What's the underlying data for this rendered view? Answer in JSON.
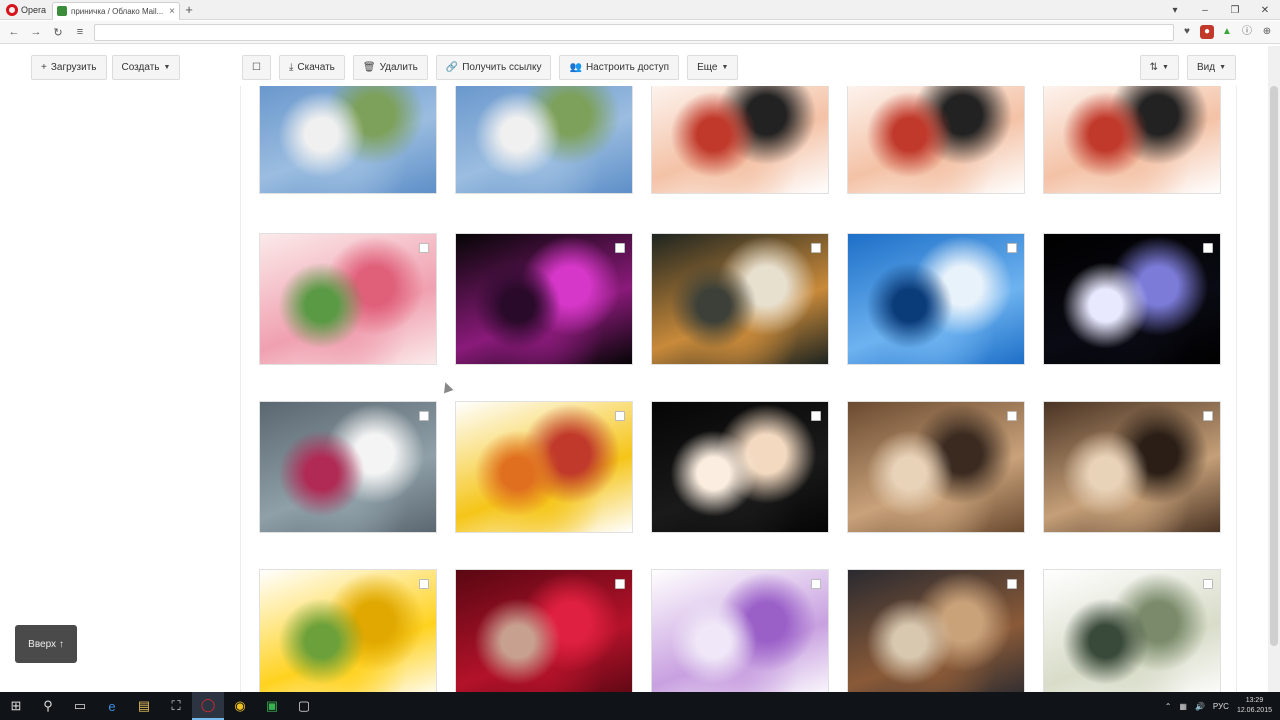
{
  "browser": {
    "menu_label": "Opera",
    "tab_title": "приничка / Облако Mail...",
    "tab_close": "×",
    "new_tab": "+"
  },
  "sidebar_actions": {
    "upload_label": "Загрузить",
    "create_label": "Создать"
  },
  "toolbar": {
    "download_label": "Скачать",
    "delete_label": "Удалить",
    "get_link_label": "Получить ссылку",
    "access_label": "Настроить доступ",
    "more_label": "Еще",
    "view_label": "Вид"
  },
  "up_button_label": "Вверх ↑",
  "taskbar": {
    "lang": "РУС",
    "time": "13:29",
    "date": "12.06.2015"
  },
  "images": [
    {
      "name": "horse-white",
      "colors": [
        "#5e8fc8",
        "#9bbde0",
        "#7da05a",
        "#f0f0f0"
      ]
    },
    {
      "name": "horse-white",
      "colors": [
        "#5e8fc8",
        "#9bbde0",
        "#7da05a",
        "#f0f0f0"
      ]
    },
    {
      "name": "sushi",
      "colors": [
        "#ffffff",
        "#f4c2a6",
        "#222222",
        "#c0392b"
      ]
    },
    {
      "name": "sushi",
      "colors": [
        "#ffffff",
        "#f4c2a6",
        "#222222",
        "#c0392b"
      ]
    },
    {
      "name": "sushi",
      "colors": [
        "#ffffff",
        "#f4c2a6",
        "#222222",
        "#c0392b"
      ]
    },
    {
      "name": "pink-roses",
      "colors": [
        "#fbeaea",
        "#f0a0b0",
        "#e0607a",
        "#5a9a45"
      ]
    },
    {
      "name": "orchid-magenta",
      "colors": [
        "#050505",
        "#8a1a7a",
        "#d637c8",
        "#2a0a2a"
      ]
    },
    {
      "name": "tiger",
      "colors": [
        "#1e2420",
        "#c98a3a",
        "#e8e0cf",
        "#3c4038"
      ]
    },
    {
      "name": "dolphin",
      "colors": [
        "#1d6fc8",
        "#6eb3f0",
        "#e8f2fb",
        "#0b3c7a"
      ]
    },
    {
      "name": "astronaut",
      "colors": [
        "#000000",
        "#0a0a14",
        "#7c7bd8",
        "#e8e8ff"
      ]
    },
    {
      "name": "white-orchid",
      "colors": [
        "#5b6770",
        "#8fa0a8",
        "#f4f4f4",
        "#b02a55"
      ]
    },
    {
      "name": "love",
      "colors": [
        "#ffffff",
        "#f5c518",
        "#c0392b",
        "#e07020"
      ]
    },
    {
      "name": "rose-cream",
      "colors": [
        "#050505",
        "#1a1a1a",
        "#f3d9c0",
        "#fbeee0"
      ]
    },
    {
      "name": "siamese-cats",
      "colors": [
        "#6a4a30",
        "#c9a27a",
        "#3a2a20",
        "#e8d2b8"
      ]
    },
    {
      "name": "siamese-cats-2",
      "colors": [
        "#4a3424",
        "#c59f78",
        "#2a1e16",
        "#e8d2b8"
      ]
    },
    {
      "name": "sunflowers",
      "colors": [
        "#ffffff",
        "#ffd21f",
        "#e0a800",
        "#6ba03a"
      ]
    },
    {
      "name": "red-roses",
      "colors": [
        "#5a0712",
        "#b3122a",
        "#e02040",
        "#c8a090"
      ]
    },
    {
      "name": "purple-flowers",
      "colors": [
        "#ffffff",
        "#c8a0e0",
        "#9a60c8",
        "#f0e8f8"
      ]
    },
    {
      "name": "horses-running",
      "colors": [
        "#2a2a30",
        "#8a5a38",
        "#c9a27a",
        "#d8c8b0"
      ]
    },
    {
      "name": "dollars",
      "colors": [
        "#ffffff",
        "#d8dcc8",
        "#7a8a6a",
        "#3a4a3a"
      ]
    }
  ]
}
